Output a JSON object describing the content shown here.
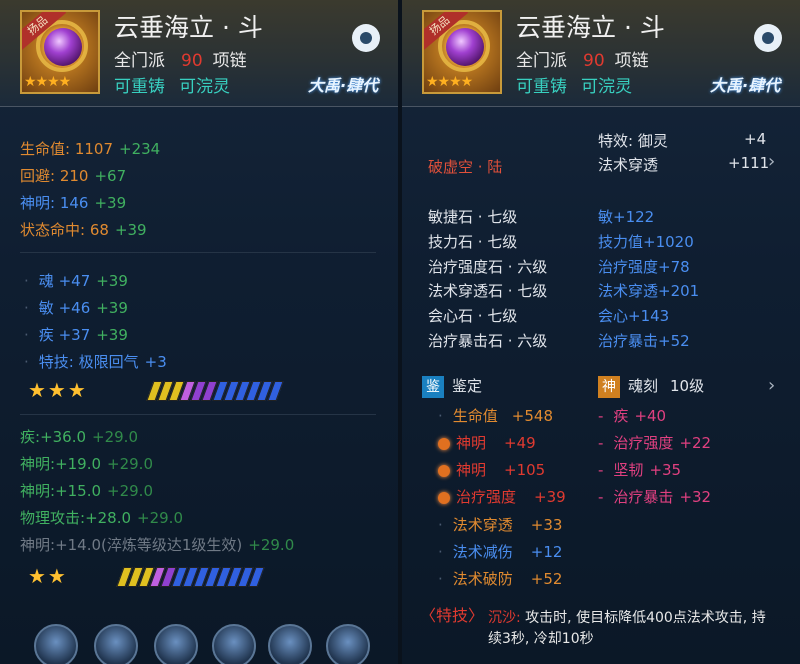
{
  "item": {
    "badge": "扬品",
    "name": "云垂海立 · 斗",
    "school": "全门派",
    "level": "90",
    "type": "项链",
    "recast": "可重铸",
    "rewash": "可浣灵",
    "series": "大禹·肆代"
  },
  "left": {
    "base_stats": [
      {
        "label": "生命值:",
        "value": "1107",
        "bonus": "+234"
      },
      {
        "label": "回避:",
        "value": "210",
        "bonus": "+67"
      },
      {
        "label": "神明:",
        "value": "146",
        "bonus": "+39"
      },
      {
        "label": "状态命中:",
        "value": "68",
        "bonus": "+39"
      }
    ],
    "attr_stats": [
      {
        "label": "魂",
        "value": "+47",
        "bonus": "+39"
      },
      {
        "label": "敏",
        "value": "+46",
        "bonus": "+39"
      },
      {
        "label": "疾",
        "value": "+37",
        "bonus": "+39"
      }
    ],
    "special": {
      "label": "特技:",
      "value": "极限回气",
      "bonus": "+3"
    },
    "refine_stats": [
      {
        "label": "疾:",
        "value": "+36.0",
        "bonus": "+29.0"
      },
      {
        "label": "神明:",
        "value": "+19.0",
        "bonus": "+29.0"
      },
      {
        "label": "神明:",
        "value": "+15.0",
        "bonus": "+29.0"
      },
      {
        "label": "物理攻击:",
        "value": "+28.0",
        "bonus": "+29.0"
      },
      {
        "label": "神明:",
        "value": "+14.0(淬炼等级达1级生效)",
        "bonus": "+29.0"
      }
    ]
  },
  "right": {
    "effects": [
      {
        "label": "特效: 御灵",
        "value": "+4"
      },
      {
        "label": "法术穿透",
        "value": "+111"
      }
    ],
    "socket": "破虚空 · 陆",
    "gems": [
      {
        "name": "敏捷石 · 七级",
        "effect": "敏+122"
      },
      {
        "name": "技力石 · 七级",
        "effect": "技力值+1020"
      },
      {
        "name": "治疗强度石 · 六级",
        "effect": "治疗强度+78"
      },
      {
        "name": "法术穿透石 · 七级",
        "effect": "法术穿透+201"
      },
      {
        "name": "会心石 · 七级",
        "effect": "会心+143"
      },
      {
        "name": "治疗暴击石 · 六级",
        "effect": "治疗暴击+52"
      }
    ],
    "appraise": {
      "tag": "鉴",
      "title": "鉴定",
      "stats": [
        {
          "label": "生命值",
          "value": "+548"
        },
        {
          "label": "神明",
          "value": "+49"
        },
        {
          "label": "神明",
          "value": "+105"
        },
        {
          "label": "治疗强度",
          "value": "+39"
        },
        {
          "label": "法术穿透",
          "value": "+33"
        },
        {
          "label": "法术减伤",
          "value": "+12"
        },
        {
          "label": "法术破防",
          "value": "+52"
        }
      ]
    },
    "soul": {
      "tag": "神",
      "title": "魂刻",
      "level": "10级",
      "stats": [
        {
          "label": "疾",
          "value": "+40"
        },
        {
          "label": "治疗强度",
          "value": "+22"
        },
        {
          "label": "坚韧",
          "value": "+35"
        },
        {
          "label": "治疗暴击",
          "value": "+32"
        }
      ]
    },
    "skill": {
      "label": "〈特技〉",
      "name": "沉沙:",
      "desc": "攻击时, 使目标降低400点法术攻击, 持续3秒, 冷却10秒"
    }
  },
  "colors": {
    "gold": "#e08a30",
    "green": "#40b060",
    "blue": "#4a8ef0",
    "teal": "#30d0c0",
    "pink": "#e04080",
    "red": "#e03a30"
  }
}
